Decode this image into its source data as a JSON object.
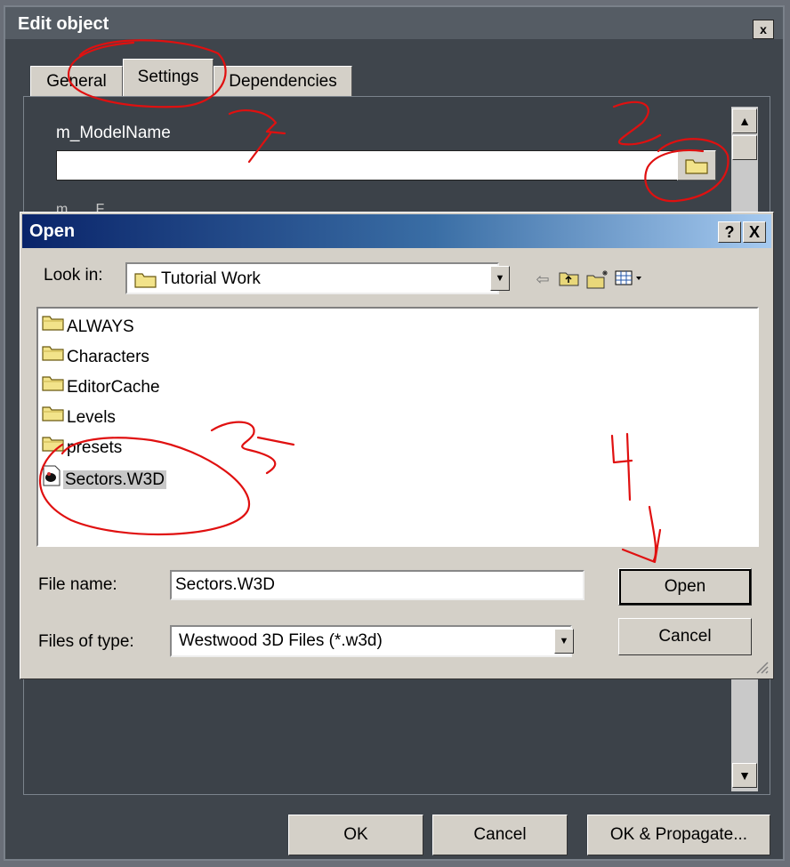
{
  "edit_window": {
    "title": "Edit object",
    "close_glyph": "x",
    "tabs": [
      {
        "label": "General"
      },
      {
        "label": "Settings"
      },
      {
        "label": "Dependencies"
      }
    ],
    "active_tab": "Settings",
    "model_name_label": "m_ModelName",
    "model_name_value": "",
    "cut_off_label": "m_ ... F...",
    "buttons": {
      "ok": "OK",
      "cancel": "Cancel",
      "ok_propagate": "OK & Propagate..."
    }
  },
  "open_dialog": {
    "title": "Open",
    "help_glyph": "?",
    "close_glyph": "X",
    "look_in_label": "Look in:",
    "look_in_value": "Tutorial Work",
    "toolbar_icons": [
      "back-arrow-icon",
      "up-folder-icon",
      "new-folder-icon",
      "views-menu-icon"
    ],
    "files": [
      {
        "name": "ALWAYS",
        "type": "folder"
      },
      {
        "name": "Characters",
        "type": "folder"
      },
      {
        "name": "EditorCache",
        "type": "folder"
      },
      {
        "name": "Levels",
        "type": "folder"
      },
      {
        "name": "presets",
        "type": "folder"
      },
      {
        "name": "Sectors.W3D",
        "type": "w3d-file",
        "selected": true
      }
    ],
    "file_name_label": "File name:",
    "file_name_value": "Sectors.W3D",
    "files_of_type_label": "Files of type:",
    "files_of_type_value": "Westwood 3D Files (*.w3d)",
    "open_button": "Open",
    "cancel_button": "Cancel"
  },
  "annotations": {
    "color": "#e01010",
    "labels": [
      "1",
      "2",
      "3",
      "4"
    ]
  }
}
